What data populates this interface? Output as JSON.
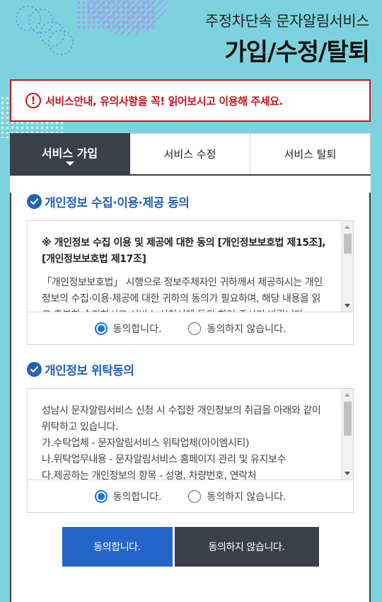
{
  "header": {
    "subtitle": "주정차단속 문자알림서비스",
    "title": "가입/수정/탈퇴"
  },
  "notice": {
    "icon": "exclamation-icon",
    "text": "서비스안내, 유의사항을 꼭! 읽어보시고 이용해 주세요.",
    "color": "#c4161c"
  },
  "tabs": [
    {
      "label": "서비스 가입",
      "active": true
    },
    {
      "label": "서비스 수정",
      "active": false
    },
    {
      "label": "서비스 탈퇴",
      "active": false
    }
  ],
  "section1": {
    "title": "개인정보 수집·이용·제공 동의",
    "heading": "※ 개인정보 수집 이용 및 제공에 대한 동의 [개인정보보호법 제15조], [개인정보보호법 제17조]",
    "body": "「개인정보보호법」 시행으로 정보주체자인 귀하께서 제공하시는 개인정보의 수집·이용·제공에 대한 귀하의 동의가 필요하며, 해당 내용을 읽고 충분히 숙지하시고 서비스 신청서에 동의 하여 주시기 바랍니다.",
    "agree_label": "동의합니다.",
    "disagree_label": "동의하지 않습니다.",
    "selected": "agree"
  },
  "section2": {
    "title": "개인정보 위탁동의",
    "lines": [
      "성남시 문자알림서비스 신청 시 수집한 개인정보의 취급을 아래와 같이 위탁하고 있습니다.",
      "가.수탁업체 - 문자알림서비스 위탁업체(아이엠시티)",
      "나.위탁업무내용 - 문자알림서비스 홈페이지 관리 및 유지보수",
      "다.제공하는 개인정보의 항목 - 성명, 차량번호, 연락처"
    ],
    "agree_label": "동의합니다.",
    "disagree_label": "동의하지 않습니다.",
    "selected": "agree"
  },
  "buttons": {
    "agree_label": "동의합니다.",
    "disagree_label": "동의하지 않습니다."
  },
  "colors": {
    "background": "#7dd3dd",
    "accent_blue": "#2261b8",
    "dark": "#3a3f4a"
  }
}
